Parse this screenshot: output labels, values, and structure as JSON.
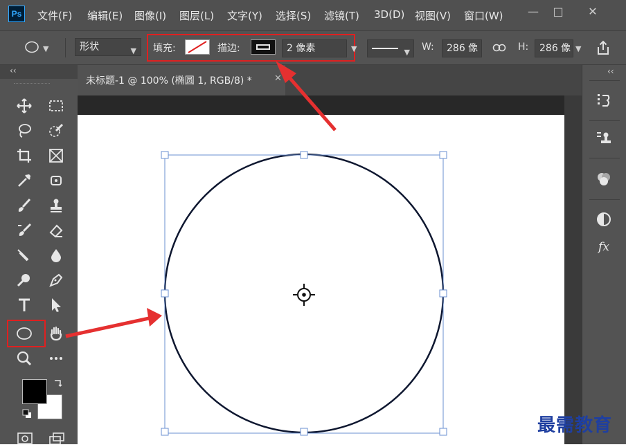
{
  "app": {
    "logo": "Ps"
  },
  "menu": {
    "items": [
      "文件(F)",
      "编辑(E)",
      "图像(I)",
      "图层(L)",
      "文字(Y)",
      "选择(S)",
      "滤镜(T)",
      "3D(D)",
      "视图(V)",
      "窗口(W)"
    ]
  },
  "window_controls": {
    "minimize": "—",
    "maximize": "□",
    "close": "✕"
  },
  "options": {
    "mode": "形状",
    "fill_label": "填充:",
    "stroke_label": "描边:",
    "stroke_width": "2 像素",
    "w_label": "W:",
    "w_value": "286 像",
    "h_label": "H:",
    "h_value": "286 像"
  },
  "collapse": {
    "left": "‹‹",
    "right": "‹‹"
  },
  "document": {
    "tab_title": "未标题-1 @ 100% (椭圆 1, RGB/8) *",
    "close": "✕"
  },
  "icons": {
    "tools": [
      "move-icon",
      "marquee-icon",
      "lasso-icon",
      "quick-select-icon",
      "crop-icon",
      "frame-icon",
      "eyedropper-icon",
      "patch-icon",
      "brush-icon",
      "stamp-icon",
      "history-brush-icon",
      "eraser-icon",
      "gradient-icon",
      "blur-icon",
      "dodge-icon",
      "pen-icon",
      "type-icon",
      "path-select-icon",
      "ellipse-icon",
      "hand-icon",
      "zoom-icon",
      "more-icon"
    ],
    "right": [
      "history-icon",
      "layers-icon",
      "channels-icon",
      "adjustments-icon",
      "styles-icon"
    ]
  },
  "right_panel": {
    "fx": "fx"
  },
  "colors": {
    "chrome": "#535353",
    "menubar": "#505050",
    "highlight": "#e02020",
    "selection": "#6a8fd0",
    "foreground": "#000000",
    "background": "#ffffff"
  },
  "watermark": "最需教育"
}
